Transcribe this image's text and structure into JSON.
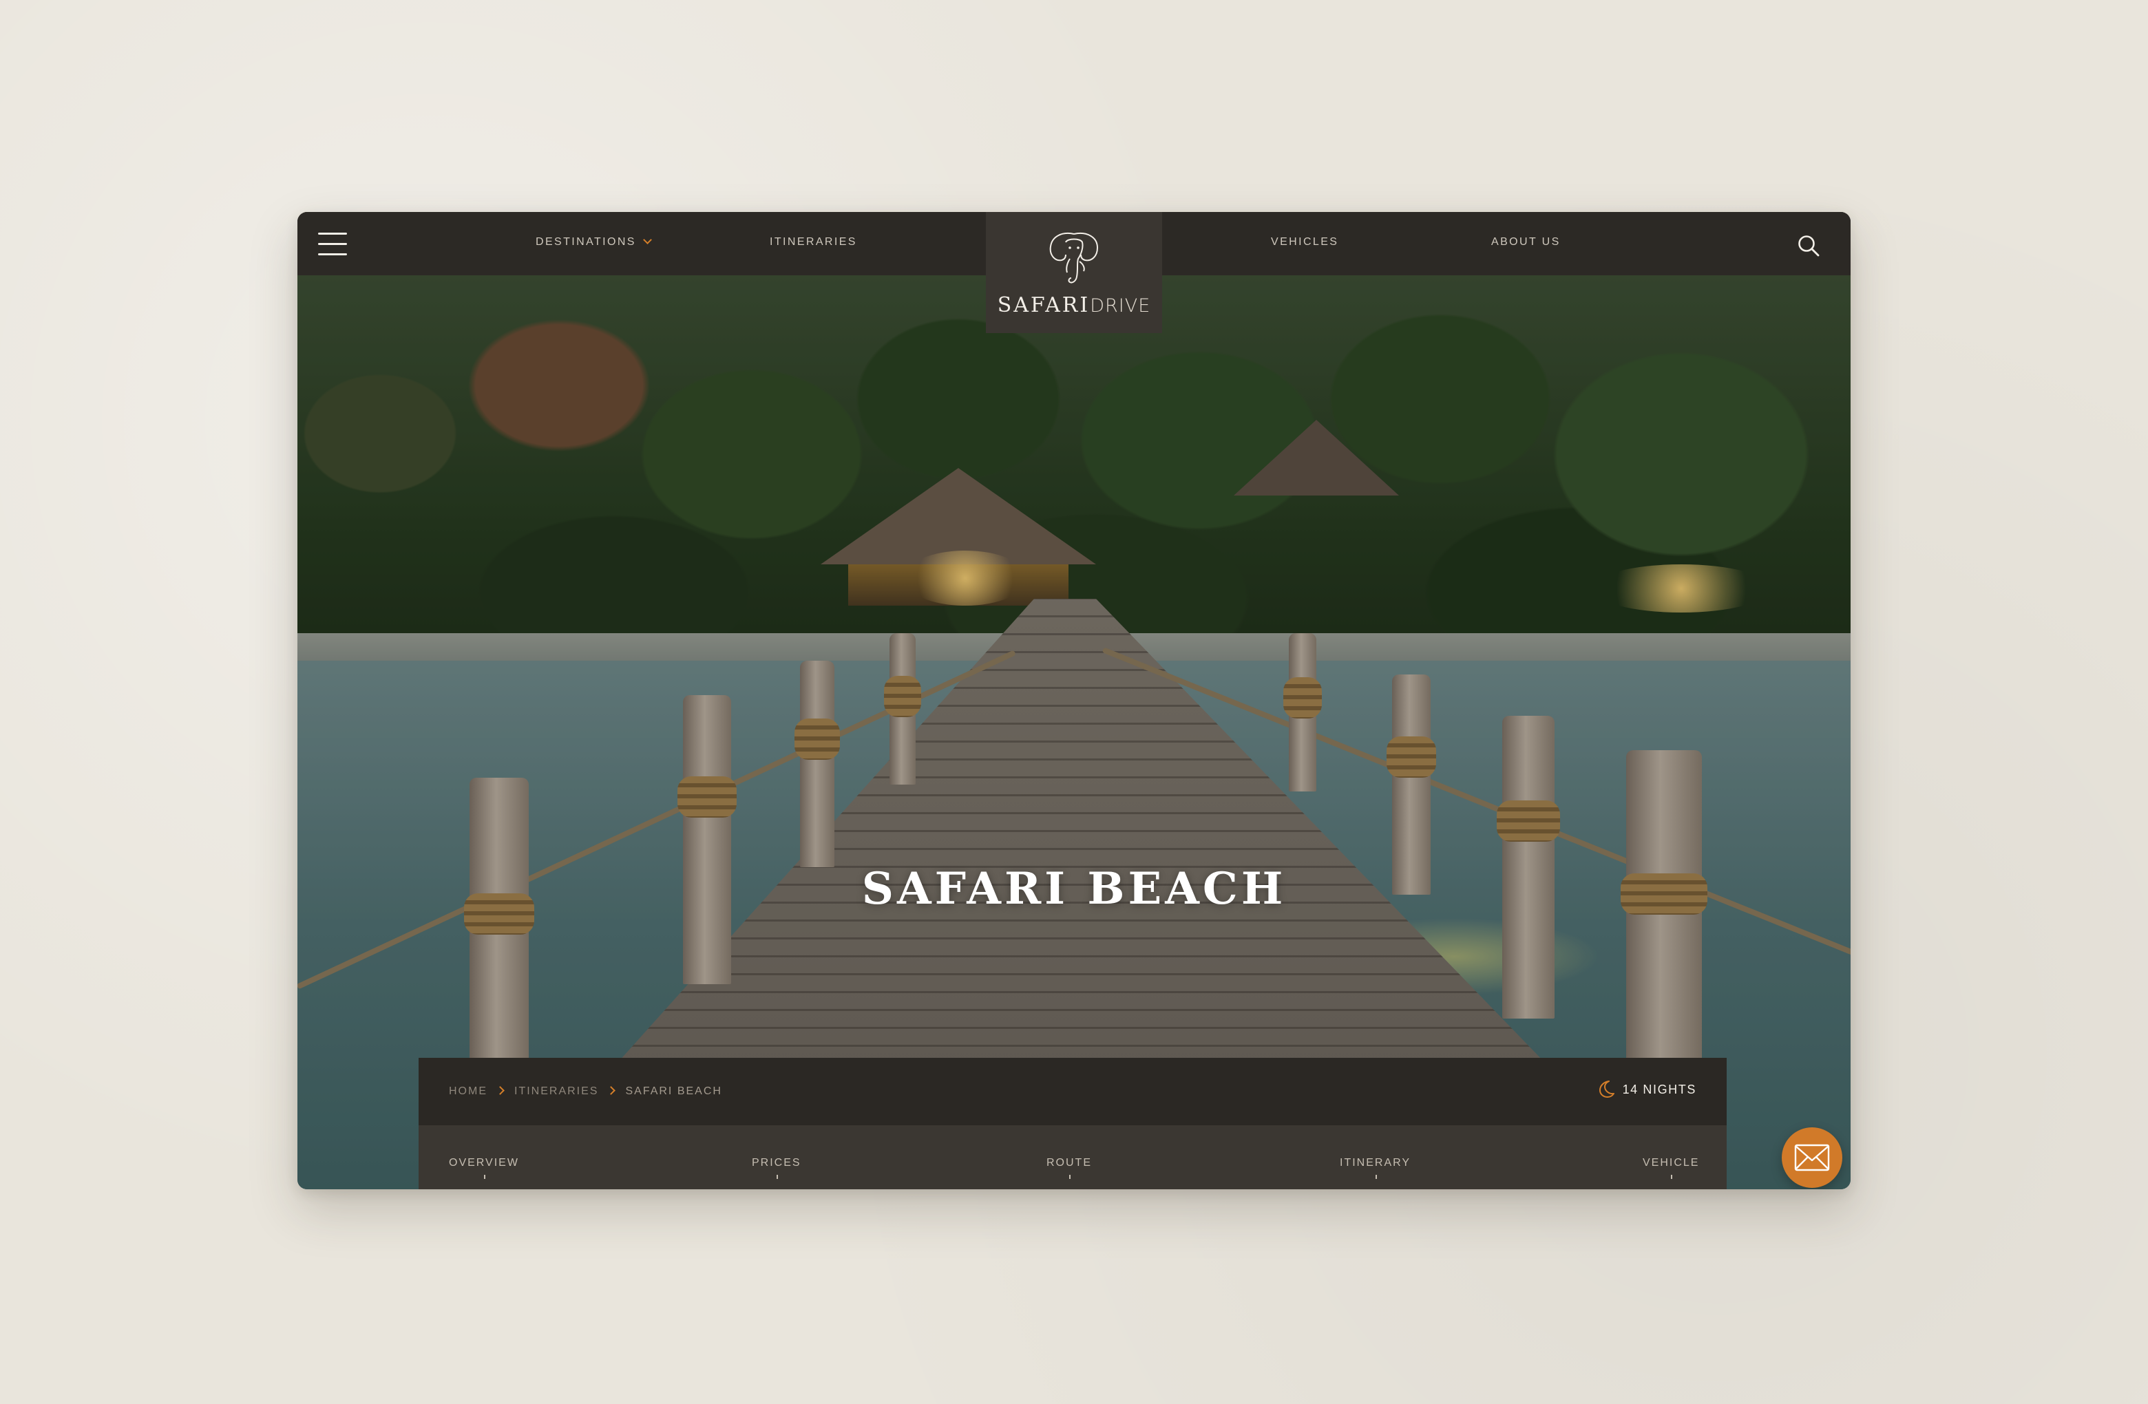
{
  "nav": {
    "destinations": "DESTINATIONS",
    "itineraries": "ITINERARIES",
    "vehicles": "VEHICLES",
    "about": "ABOUT US"
  },
  "logo": {
    "strong": "SAFARI",
    "light": "DRIVE"
  },
  "hero": {
    "title": "SAFARI BEACH"
  },
  "breadcrumb": {
    "items": [
      "HOME",
      "ITINERARIES",
      "SAFARI BEACH"
    ]
  },
  "trip": {
    "nights": "14 NIGHTS"
  },
  "tabs": [
    "OVERVIEW",
    "PRICES",
    "ROUTE",
    "ITINERARY",
    "VEHICLE"
  ],
  "icons": {
    "menu": "hamburger-icon",
    "search": "search-icon",
    "dropdown": "chevron-down-icon",
    "crumb_separator": "chevron-right-icon",
    "nights": "moon-icon",
    "mail": "envelope-icon",
    "logo": "elephant-icon"
  },
  "colors": {
    "nav_bg": "#2c2925",
    "logo_bg": "#3a3631",
    "accent": "#d17a29",
    "page_bg": "#e9e5dc"
  }
}
